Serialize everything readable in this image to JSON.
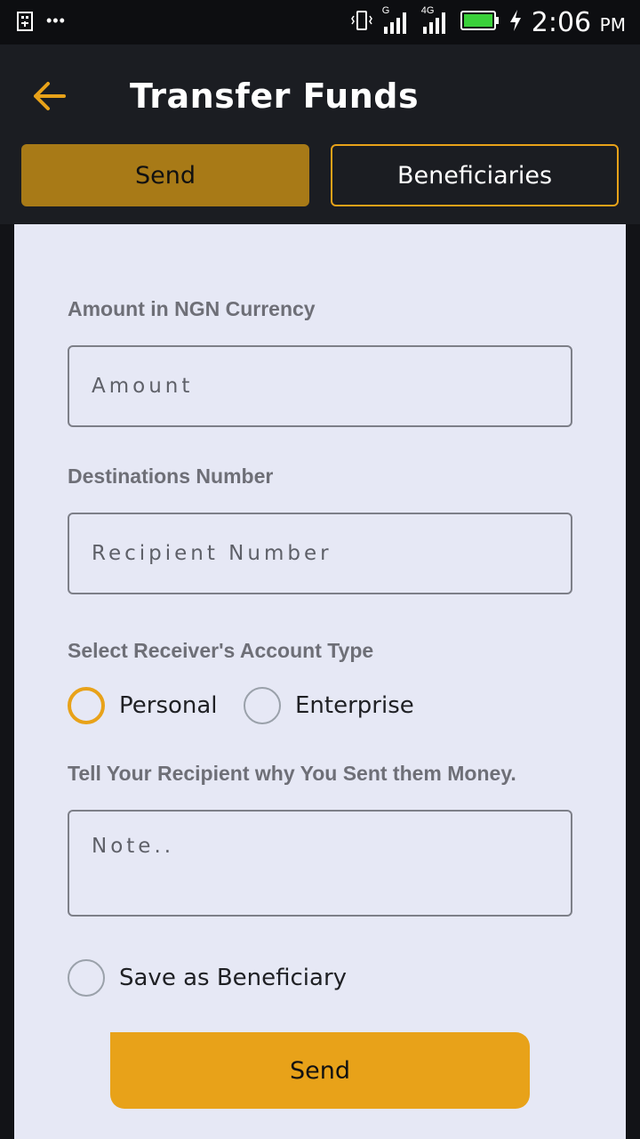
{
  "status_bar": {
    "time": "2:06",
    "am_pm": "PM",
    "network_1": "G",
    "network_2": "4G",
    "icons": [
      "usb-icon",
      "more-dots-icon",
      "vibrate-icon",
      "signal-icon",
      "signal-icon",
      "battery-icon",
      "charging-icon"
    ]
  },
  "header": {
    "title": "Transfer Funds",
    "tabs": [
      {
        "label": "Send",
        "active": true
      },
      {
        "label": "Beneficiaries",
        "active": false
      }
    ]
  },
  "form": {
    "amount_label": "Amount in NGN Currency",
    "amount_placeholder": "Amount",
    "amount_value": "",
    "destination_label": "Destinations Number",
    "destination_placeholder": "Recipient Number",
    "destination_value": "",
    "account_type_label": "Select Receiver's Account Type",
    "account_types": [
      {
        "label": "Personal",
        "selected": true
      },
      {
        "label": "Enterprise",
        "selected": false
      }
    ],
    "note_label": "Tell Your Recipient why You Sent them Money.",
    "note_placeholder": "Note..",
    "note_value": "",
    "save_beneficiary_label": "Save as Beneficiary",
    "save_beneficiary_checked": false,
    "submit_label": "Send"
  },
  "colors": {
    "accent": "#e8a219",
    "tab_active": "#a87a17",
    "header_bg": "#1b1d22",
    "card_bg": "#e6e8f5"
  }
}
